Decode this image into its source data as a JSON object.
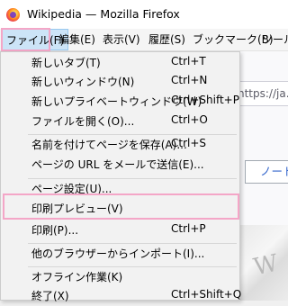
{
  "window": {
    "title": "Wikipedia — Mozilla Firefox",
    "logo_icon": "firefox-logo-icon"
  },
  "menubar": {
    "items": [
      {
        "label": "ファイル(F)"
      },
      {
        "label": "編集(E)"
      },
      {
        "label": "表示(V)"
      },
      {
        "label": "履歴(S)"
      },
      {
        "label": "ブックマーク(B)"
      },
      {
        "label": "ツール"
      }
    ]
  },
  "background": {
    "url_text": "https://ja.wi",
    "page_tab_label": "ノート"
  },
  "file_menu": {
    "items": [
      {
        "label": "新しいタブ(T)",
        "shortcut": "Ctrl+T"
      },
      {
        "label": "新しいウィンドウ(N)",
        "shortcut": "Ctrl+N"
      },
      {
        "label": "新しいプライベートウィンドウ(W)",
        "shortcut": "Ctrl+Shift+P"
      },
      {
        "label": "ファイルを開く(O)...",
        "shortcut": "Ctrl+O"
      },
      {
        "label": "名前を付けてページを保存(A)...",
        "shortcut": "Ctrl+S"
      },
      {
        "label": "ページの URL をメールで送信(E)...",
        "shortcut": ""
      },
      {
        "label": "ページ設定(U)...",
        "shortcut": ""
      },
      {
        "label": "印刷プレビュー(V)",
        "shortcut": ""
      },
      {
        "label": "印刷(P)...",
        "shortcut": "Ctrl+P"
      },
      {
        "label": "他のブラウザーからインポート(I)...",
        "shortcut": ""
      },
      {
        "label": "オフライン作業(K)",
        "shortcut": ""
      },
      {
        "label": "終了(X)",
        "shortcut": "Ctrl+Shift+Q"
      }
    ]
  },
  "colors": {
    "highlight_border": "#f4a6c7",
    "menu_background": "#f2f2f2",
    "active_menu": "#cce4f7"
  }
}
